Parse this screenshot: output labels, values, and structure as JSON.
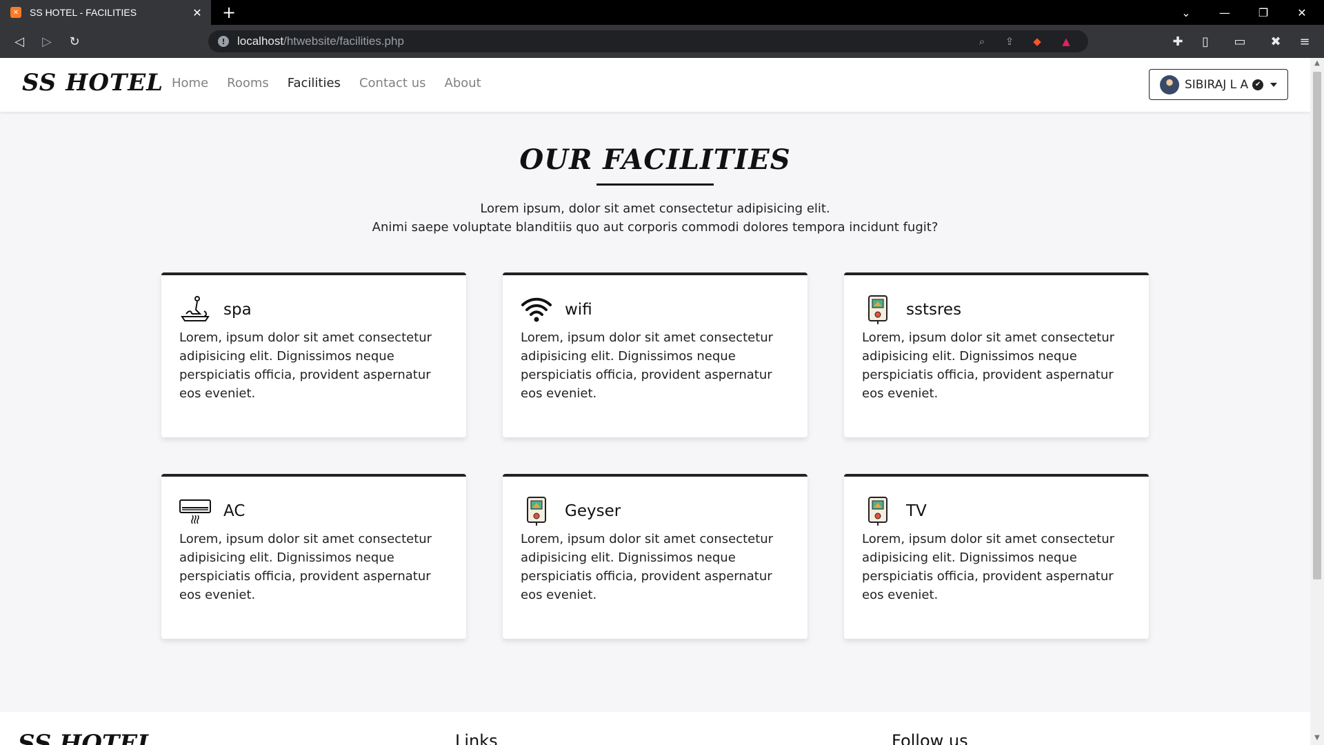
{
  "browser": {
    "tab_title": "SS HOTEL - FACILITIES",
    "url_host": "localhost",
    "url_path": "/htwebsite/facilities.php"
  },
  "nav": {
    "brand": "SS HOTEL",
    "links": [
      "Home",
      "Rooms",
      "Facilities",
      "Contact us",
      "About"
    ],
    "active": "Facilities",
    "user_name": "SIBIRAJ L A"
  },
  "section": {
    "heading": "OUR FACILITIES",
    "intro_line1": "Lorem ipsum, dolor sit amet consectetur adipisicing elit.",
    "intro_line2": "Animi saepe voluptate blanditiis quo aut corporis commodi dolores tempora incidunt fugit?"
  },
  "facilities": [
    {
      "title": "spa",
      "icon": "spa-icon",
      "text": "Lorem, ipsum dolor sit amet consectetur adipisicing elit. Dignissimos neque perspiciatis officia, provident aspernatur eos eveniet."
    },
    {
      "title": "wifi",
      "icon": "wifi-icon",
      "text": "Lorem, ipsum dolor sit amet consectetur adipisicing elit. Dignissimos neque perspiciatis officia, provident aspernatur eos eveniet."
    },
    {
      "title": "sstsres",
      "icon": "heater-icon",
      "text": "Lorem, ipsum dolor sit amet consectetur adipisicing elit. Dignissimos neque perspiciatis officia, provident aspernatur eos eveniet."
    },
    {
      "title": "AC",
      "icon": "air-conditioner-icon",
      "text": "Lorem, ipsum dolor sit amet consectetur adipisicing elit. Dignissimos neque perspiciatis officia, provident aspernatur eos eveniet."
    },
    {
      "title": "Geyser",
      "icon": "heater-icon",
      "text": "Lorem, ipsum dolor sit amet consectetur adipisicing elit. Dignissimos neque perspiciatis officia, provident aspernatur eos eveniet."
    },
    {
      "title": "TV",
      "icon": "heater-icon",
      "text": "Lorem, ipsum dolor sit amet consectetur adipisicing elit. Dignissimos neque perspiciatis officia, provident aspernatur eos eveniet."
    }
  ],
  "footer": {
    "brand": "SS HOTEL",
    "links_heading": "Links",
    "follow_heading": "Follow us"
  }
}
